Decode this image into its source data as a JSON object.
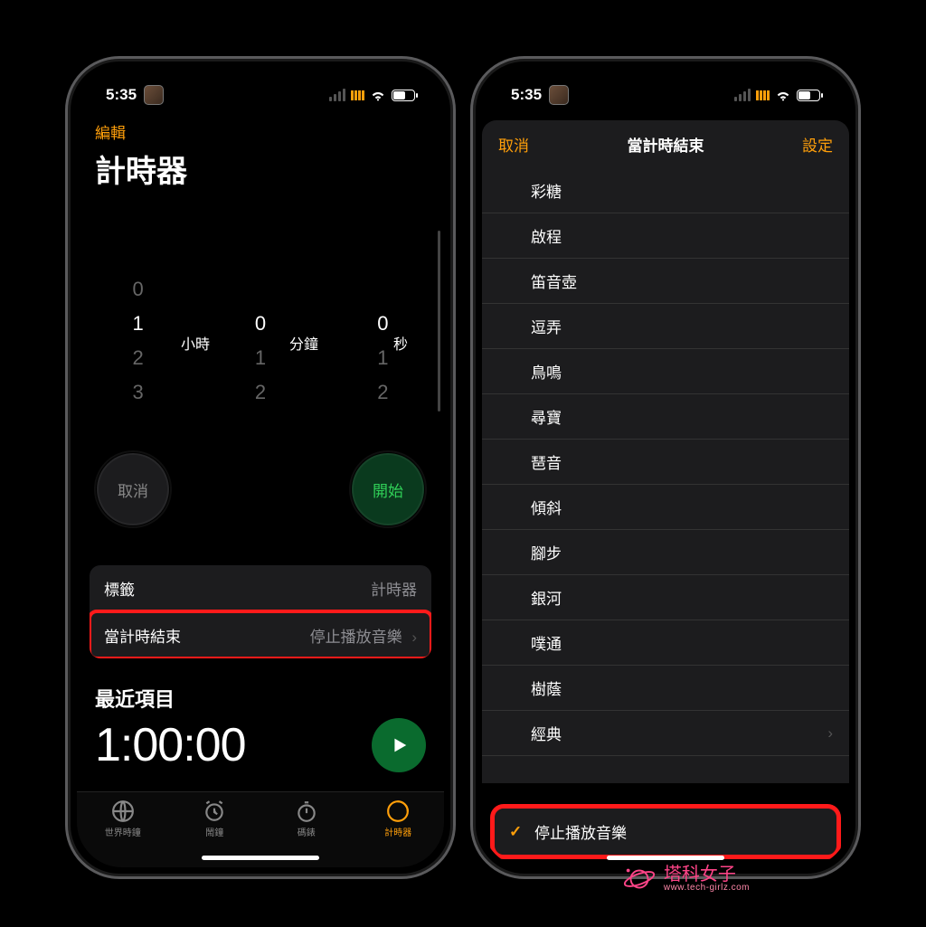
{
  "status": {
    "time": "5:35"
  },
  "left": {
    "edit_label": "編輯",
    "title": "計時器",
    "picker": {
      "hours_label": "小時",
      "minutes_label": "分鐘",
      "seconds_label": "秒",
      "hours": {
        "prev": "0",
        "selected": "1",
        "next1": "2",
        "next2": "3"
      },
      "minutes": {
        "selected": "0",
        "next1": "1",
        "next2": "2"
      },
      "seconds": {
        "selected": "0",
        "next1": "1",
        "next2": "2"
      }
    },
    "cancel_label": "取消",
    "start_label": "開始",
    "label_row": {
      "title": "標籤",
      "value": "計時器"
    },
    "ends_row": {
      "title": "當計時結束",
      "value": "停止播放音樂"
    },
    "recent_header": "最近項目",
    "recent_time": "1:00:00",
    "tabs": {
      "world_clock": "世界時鐘",
      "alarm": "鬧鐘",
      "stopwatch": "碼錶",
      "timer": "計時器"
    }
  },
  "right": {
    "cancel_label": "取消",
    "title": "當計時結束",
    "set_label": "設定",
    "sounds": [
      "彩糖",
      "啟程",
      "笛音壺",
      "逗弄",
      "鳥鳴",
      "尋寶",
      "琶音",
      "傾斜",
      "腳步",
      "銀河",
      "噗通",
      "樹蔭"
    ],
    "classic_label": "經典",
    "stop_label": "停止播放音樂"
  },
  "watermark": {
    "name": "塔科女子",
    "url": "www.tech-girlz.com"
  }
}
